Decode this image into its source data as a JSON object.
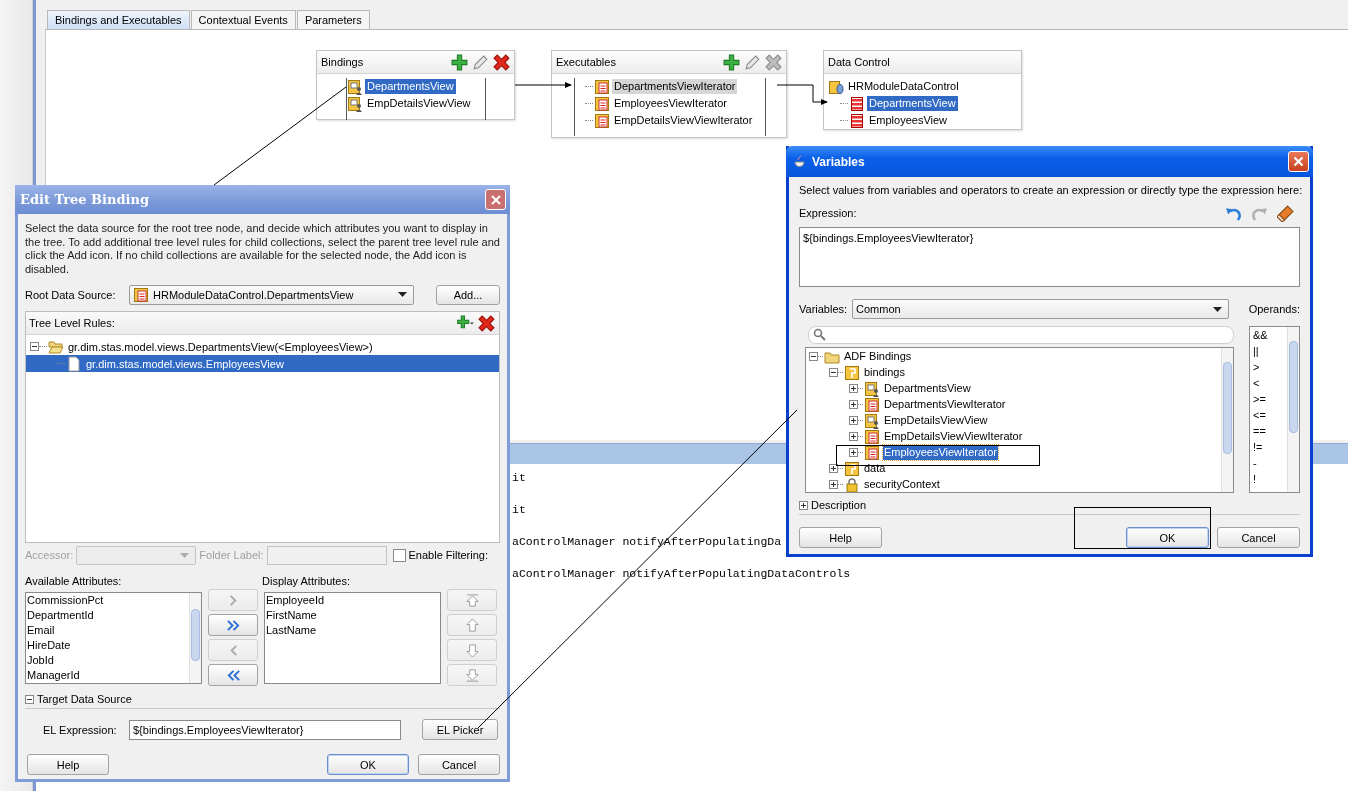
{
  "editor_tabs": [
    {
      "label": "Bindings and Executables",
      "selected": true
    },
    {
      "label": "Contextual Events",
      "selected": false
    },
    {
      "label": "Parameters",
      "selected": false
    }
  ],
  "diagram_panels": [
    {
      "title": "Bindings",
      "focused": true,
      "toolbar": [
        {
          "kind": "add",
          "disabled": false
        },
        {
          "kind": "edit",
          "disabled": false
        },
        {
          "kind": "delete",
          "disabled": false
        }
      ],
      "items": [
        {
          "label": "DepartmentsView",
          "kind": "binding",
          "selected": true
        },
        {
          "label": "EmpDetailsViewView",
          "kind": "binding",
          "selected": false
        }
      ]
    },
    {
      "title": "Executables",
      "focused": false,
      "toolbar": [
        {
          "kind": "add",
          "disabled": false
        },
        {
          "kind": "edit",
          "disabled": false
        },
        {
          "kind": "delete",
          "disabled": true
        }
      ],
      "items": [
        {
          "label": "DepartmentsViewIterator",
          "kind": "iterator",
          "selected": true
        },
        {
          "label": "EmployeesViewIterator",
          "kind": "iterator",
          "selected": false
        },
        {
          "label": "EmpDetailsViewViewIterator",
          "kind": "iterator",
          "selected": false
        }
      ]
    },
    {
      "title": "Data Control",
      "focused": true,
      "items": [
        {
          "label": "HRModuleDataControl",
          "kind": "datacontrol",
          "selected": false,
          "children": [
            {
              "label": "DepartmentsView",
              "kind": "view",
              "selected": true
            },
            {
              "label": "EmployeesView",
              "kind": "view",
              "selected": false
            }
          ]
        }
      ]
    }
  ],
  "log_lines": [
    "it",
    "it",
    "aControlManager notifyAfterPopulatingDa",
    "aControlManager notifyAfterPopulatingDataControls"
  ],
  "edit_tree_binding": {
    "title": "Edit Tree Binding",
    "description": "Select the data source for the root tree node, and decide which attributes you want to display in the tree. To add additional tree level rules for child collections, select the parent tree level rule and click the Add icon. If no child collections are available for the selected node, the Add icon is disabled.",
    "root_source_label": "Root Data Source:",
    "root_source": "HRModuleDataControl.DepartmentsView",
    "add_button": "Add...",
    "rules_label": "Tree Level Rules:",
    "rules_toolbar": [
      {
        "kind": "add-menu",
        "disabled": false
      },
      {
        "kind": "delete",
        "disabled": false
      }
    ],
    "rules": [
      {
        "label": "gr.dim.stas.model.views.DepartmentsView(<EmployeesView>)",
        "kind": "folderopen",
        "expanded": true,
        "selected": false,
        "children": [
          {
            "label": "gr.dim.stas.model.views.EmployeesView",
            "kind": "file",
            "selected": true
          }
        ]
      }
    ],
    "accessor": {
      "label": "Accessor:",
      "disabled": true
    },
    "folder_label": {
      "label": "Folder Label:",
      "disabled": true
    },
    "enable_filtering": {
      "label": "Enable Filtering:",
      "checked": false
    },
    "available_label": "Available Attributes:",
    "available": [
      "CommissionPct",
      "DepartmentId",
      "Email",
      "HireDate",
      "JobId",
      "ManagerId"
    ],
    "display_label": "Display Attributes:",
    "display": [
      "EmployeeId",
      "FirstName",
      "LastName"
    ],
    "shuttle_buttons": [
      {
        "kind": "right",
        "disabled": true
      },
      {
        "kind": "all-right",
        "disabled": false
      },
      {
        "kind": "left",
        "disabled": true
      },
      {
        "kind": "all-left",
        "disabled": false
      }
    ],
    "order_buttons": [
      {
        "kind": "top",
        "disabled": true
      },
      {
        "kind": "up",
        "disabled": true
      },
      {
        "kind": "down",
        "disabled": true
      },
      {
        "kind": "bottom",
        "disabled": true
      }
    ],
    "target_section": {
      "label": "Target Data Source",
      "expanded": true
    },
    "el_label": "EL Expression:",
    "el_value": "${bindings.EmployeesViewIterator}",
    "el_picker": "EL Picker",
    "buttons": [
      {
        "label": "Help",
        "kind": "help",
        "default": false
      },
      {
        "label": "OK",
        "kind": "ok",
        "default": true
      },
      {
        "label": "Cancel",
        "kind": "cancel",
        "default": false
      }
    ]
  },
  "variables_dialog": {
    "title": "Variables",
    "description": "Select values from variables and operators to create an expression or directly type the expression here:",
    "expression_label": "Expression:",
    "toolbar": [
      {
        "kind": "undo",
        "disabled": false
      },
      {
        "kind": "redo",
        "disabled": true
      },
      {
        "kind": "clear",
        "disabled": false
      }
    ],
    "expression": "${bindings.EmployeesViewIterator}",
    "variables_label": "Variables:",
    "variables_value": "Common",
    "operands_label": "Operands:",
    "tree": [
      {
        "label": "ADF Bindings",
        "kind": "folder",
        "expanded": true,
        "selected": false,
        "children": [
          {
            "label": "bindings",
            "kind": "package",
            "expanded": true,
            "selected": false,
            "children": [
              {
                "label": "DepartmentsView",
                "kind": "binding",
                "expanded": false,
                "selected": false
              },
              {
                "label": "DepartmentsViewIterator",
                "kind": "iterator",
                "expanded": false,
                "selected": false
              },
              {
                "label": "EmpDetailsViewView",
                "kind": "binding",
                "expanded": false,
                "selected": false
              },
              {
                "label": "EmpDetailsViewViewIterator",
                "kind": "iterator",
                "expanded": false,
                "selected": false
              },
              {
                "label": "EmployeesViewIterator",
                "kind": "iterator",
                "expanded": false,
                "selected": true
              }
            ]
          },
          {
            "label": "data",
            "kind": "package",
            "expanded": false,
            "selected": false
          },
          {
            "label": "securityContext",
            "kind": "lock",
            "expanded": false,
            "selected": false
          }
        ]
      }
    ],
    "operands": [
      "&&",
      "||",
      ">",
      "<",
      ">=",
      "<=",
      "==",
      "!=",
      "-",
      "!"
    ],
    "description_section": {
      "label": "Description",
      "expanded": false
    },
    "buttons": [
      {
        "label": "Help",
        "kind": "help",
        "default": false
      },
      {
        "label": "OK",
        "kind": "ok",
        "default": true
      },
      {
        "label": "Cancel",
        "kind": "cancel",
        "default": false
      }
    ]
  }
}
